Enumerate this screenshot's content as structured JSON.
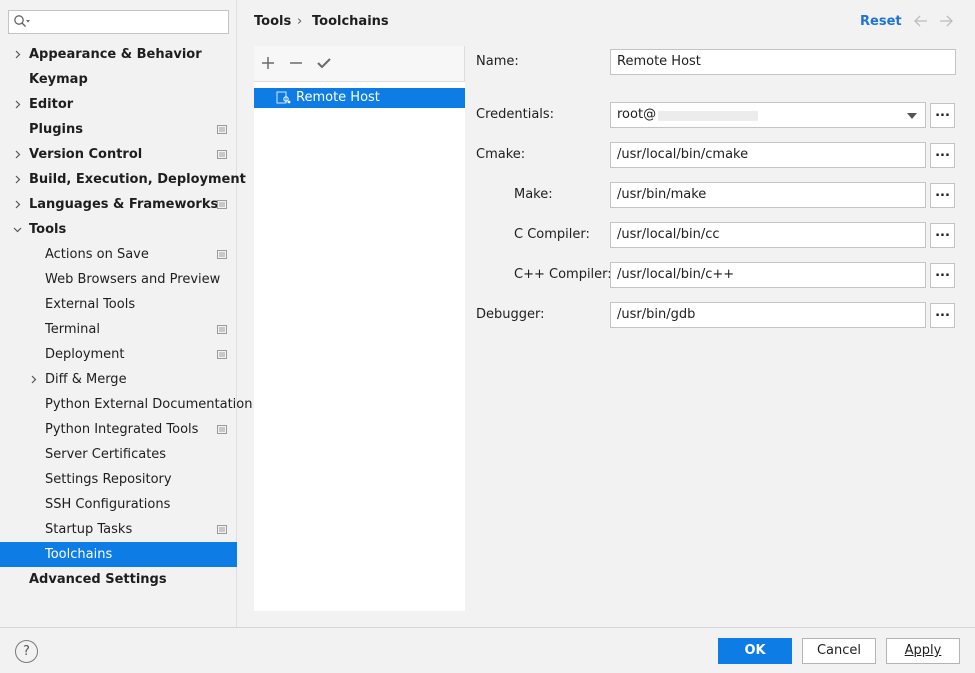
{
  "search": {
    "placeholder": "",
    "icon": "search-icon"
  },
  "sidebar": {
    "items": [
      {
        "label": "Appearance & Behavior",
        "level": 0,
        "chevron": "right",
        "project": false
      },
      {
        "label": "Keymap",
        "level": 0,
        "chevron": "none",
        "project": false
      },
      {
        "label": "Editor",
        "level": 0,
        "chevron": "right",
        "project": false
      },
      {
        "label": "Plugins",
        "level": 0,
        "chevron": "none",
        "project": true
      },
      {
        "label": "Version Control",
        "level": 0,
        "chevron": "right",
        "project": true
      },
      {
        "label": "Build, Execution, Deployment",
        "level": 0,
        "chevron": "right",
        "project": false
      },
      {
        "label": "Languages & Frameworks",
        "level": 0,
        "chevron": "right",
        "project": true
      },
      {
        "label": "Tools",
        "level": 0,
        "chevron": "down",
        "project": false
      },
      {
        "label": "Actions on Save",
        "level": 1,
        "chevron": "none",
        "project": true
      },
      {
        "label": "Web Browsers and Preview",
        "level": 1,
        "chevron": "none",
        "project": false
      },
      {
        "label": "External Tools",
        "level": 1,
        "chevron": "none",
        "project": false
      },
      {
        "label": "Terminal",
        "level": 1,
        "chevron": "none",
        "project": true
      },
      {
        "label": "Deployment",
        "level": 1,
        "chevron": "none",
        "project": true
      },
      {
        "label": "Diff & Merge",
        "level": 1,
        "chevron": "right",
        "project": false
      },
      {
        "label": "Python External Documentation",
        "level": 1,
        "chevron": "none",
        "project": false
      },
      {
        "label": "Python Integrated Tools",
        "level": 1,
        "chevron": "none",
        "project": true
      },
      {
        "label": "Server Certificates",
        "level": 1,
        "chevron": "none",
        "project": false
      },
      {
        "label": "Settings Repository",
        "level": 1,
        "chevron": "none",
        "project": false
      },
      {
        "label": "SSH Configurations",
        "level": 1,
        "chevron": "none",
        "project": false
      },
      {
        "label": "Startup Tasks",
        "level": 1,
        "chevron": "none",
        "project": true
      },
      {
        "label": "Toolchains",
        "level": 1,
        "chevron": "none",
        "project": false,
        "selected": true
      },
      {
        "label": "Advanced Settings",
        "level": 0,
        "chevron": "none",
        "project": false
      }
    ]
  },
  "header": {
    "breadcrumb": [
      "Tools",
      "Toolchains"
    ],
    "separator": "›",
    "reset_label": "Reset"
  },
  "toolchains": {
    "items": [
      {
        "label": "Remote Host",
        "selected": true
      }
    ]
  },
  "form": {
    "name_label": "Name:",
    "name_value": "Remote Host",
    "credentials_label": "Credentials:",
    "credentials_value": "root@",
    "cmake_label": "Cmake:",
    "cmake_value": "/usr/local/bin/cmake",
    "make_label": "Make:",
    "make_value": "/usr/bin/make",
    "c_compiler_label": "C Compiler:",
    "c_compiler_value": "/usr/local/bin/cc",
    "cpp_compiler_label": "C++ Compiler:",
    "cpp_compiler_value": "/usr/local/bin/c++",
    "debugger_label": "Debugger:",
    "debugger_value": "/usr/bin/gdb",
    "browse_label": "..."
  },
  "footer": {
    "help_label": "?",
    "ok_label": "OK",
    "cancel_label": "Cancel",
    "apply_label": "Apply"
  },
  "colors": {
    "accent": "#0d7de5",
    "link": "#1f73d6"
  }
}
